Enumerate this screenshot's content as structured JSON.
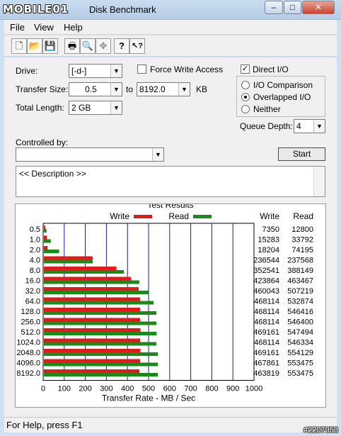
{
  "window": {
    "logo_text": "MOBILE01",
    "title": "Disk Benchmark",
    "minimize_glyph": "–",
    "maximize_glyph": "□",
    "close_glyph": "✕"
  },
  "menu": [
    "File",
    "View",
    "Help"
  ],
  "toolbar_icons": [
    "new-icon",
    "open-icon",
    "save-icon",
    "print-icon",
    "print-preview-icon",
    "move-icon",
    "help-icon",
    "context-help-icon"
  ],
  "toolbar_glyphs": [
    "🗋",
    "📂",
    "💾",
    "🖶",
    "🔍",
    "✥",
    "?",
    "↖?"
  ],
  "settings": {
    "drive_label": "Drive:",
    "drive_value": "[-d-]",
    "transfer_size_label": "Transfer Size:",
    "transfer_from": "0.5",
    "transfer_to_label": "to",
    "transfer_to": "8192.0",
    "transfer_unit": "KB",
    "total_length_label": "Total Length:",
    "total_length_value": "2 GB",
    "force_write_label": "Force Write Access",
    "force_write_checked": false,
    "direct_io_label": "Direct I/O",
    "direct_io_checked": true,
    "io_mode_options": [
      "I/O Comparison",
      "Overlapped I/O",
      "Neither"
    ],
    "io_mode_selected": "Overlapped I/O",
    "queue_depth_label": "Queue Depth:",
    "queue_depth_value": "4",
    "controlled_by_label": "Controlled by:",
    "controlled_by_value": "",
    "start_label": "Start",
    "description_text": "<< Description >>"
  },
  "results": {
    "title": "Test Results",
    "write_header": "Write",
    "read_header": "Read",
    "rows": [
      {
        "size": "0.5",
        "write": "7350",
        "read": "12800"
      },
      {
        "size": "1.0",
        "write": "15283",
        "read": "33792"
      },
      {
        "size": "2.0",
        "write": "18204",
        "read": "74195"
      },
      {
        "size": "4.0",
        "write": "236544",
        "read": "237568"
      },
      {
        "size": "8.0",
        "write": "352541",
        "read": "388149"
      },
      {
        "size": "16.0",
        "write": "423864",
        "read": "463467"
      },
      {
        "size": "32.0",
        "write": "460043",
        "read": "507219"
      },
      {
        "size": "64.0",
        "write": "468114",
        "read": "532874"
      },
      {
        "size": "128.0",
        "write": "468114",
        "read": "546416"
      },
      {
        "size": "256.0",
        "write": "468114",
        "read": "546400"
      },
      {
        "size": "512.0",
        "write": "469161",
        "read": "547494"
      },
      {
        "size": "1024.0",
        "write": "468114",
        "read": "546334"
      },
      {
        "size": "2048.0",
        "write": "469161",
        "read": "554129"
      },
      {
        "size": "4096.0",
        "write": "467861",
        "read": "553475"
      },
      {
        "size": "8192.0",
        "write": "463819",
        "read": "553475"
      }
    ]
  },
  "chart_data": {
    "type": "bar",
    "orientation": "horizontal",
    "categories": [
      "0.5",
      "1.0",
      "2.0",
      "4.0",
      "8.0",
      "16.0",
      "32.0",
      "64.0",
      "128.0",
      "256.0",
      "512.0",
      "1024.0",
      "2048.0",
      "4096.0",
      "8192.0"
    ],
    "series": [
      {
        "name": "Write",
        "color": "#e21a1a",
        "values": [
          7.2,
          14.9,
          17.8,
          231.0,
          344.3,
          413.9,
          449.3,
          457.1,
          457.1,
          457.1,
          458.2,
          457.1,
          458.2,
          456.9,
          452.9
        ]
      },
      {
        "name": "Read",
        "color": "#1a8a1a",
        "values": [
          12.5,
          33.0,
          72.5,
          232.0,
          379.1,
          452.6,
          495.3,
          520.4,
          533.6,
          533.6,
          534.7,
          533.5,
          541.1,
          540.5,
          540.5
        ]
      }
    ],
    "xlabel": "Transfer Rate - MB / Sec",
    "xlim": [
      0,
      1000
    ],
    "xticks": [
      "0",
      "100",
      "200",
      "300",
      "400",
      "500",
      "600",
      "700",
      "800",
      "900",
      "1000"
    ],
    "grid": "vertical",
    "legend": "top"
  },
  "statusbar": {
    "text": "For Help, press F1"
  },
  "watermark": "#2207953"
}
